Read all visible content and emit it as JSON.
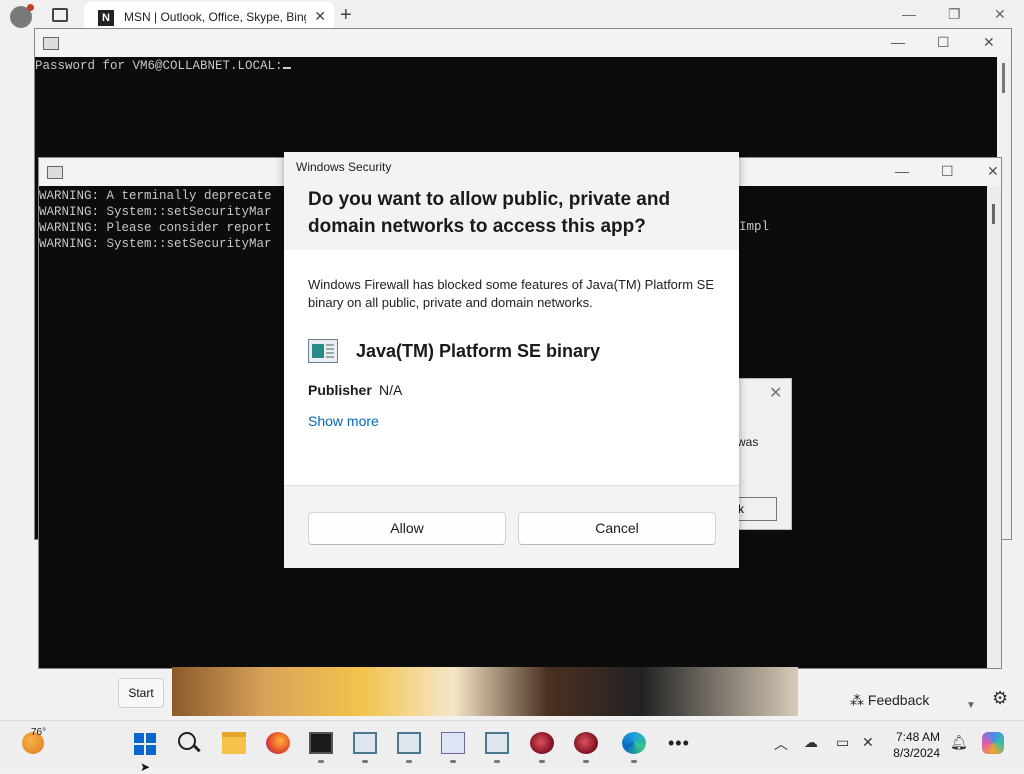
{
  "browser": {
    "tab_title": "MSN | Outlook, Office, Skype, Bing",
    "tab_favicon_letter": "N"
  },
  "terminal1": {
    "prompt_text": "Password for VM6@COLLABNET.LOCAL:"
  },
  "terminal2": {
    "lines": [
      "WARNING: A terminally deprecate",
      "WARNING: System::setSecurityMar",
      "WARNING: Please consider report",
      "WARNING: System::setSecurityMar"
    ],
    "overflow_text": "Impl"
  },
  "background_dialog": {
    "text": "was",
    "button": "k"
  },
  "security_dialog": {
    "window_title": "Windows Security",
    "question": "Do you want to allow public, private and domain networks to access this app?",
    "description": "Windows Firewall has blocked some features of Java(TM) Platform SE binary on all public, private and domain networks.",
    "app_name": "Java(TM) Platform SE binary",
    "publisher_label": "Publisher",
    "publisher_value": "N/A",
    "show_more": "Show more",
    "allow_button": "Allow",
    "cancel_button": "Cancel"
  },
  "start_tooltip": "Start",
  "feedback_label": "Feedback",
  "taskbar": {
    "temperature": "76°",
    "time": "7:48 AM",
    "date": "8/3/2024"
  }
}
